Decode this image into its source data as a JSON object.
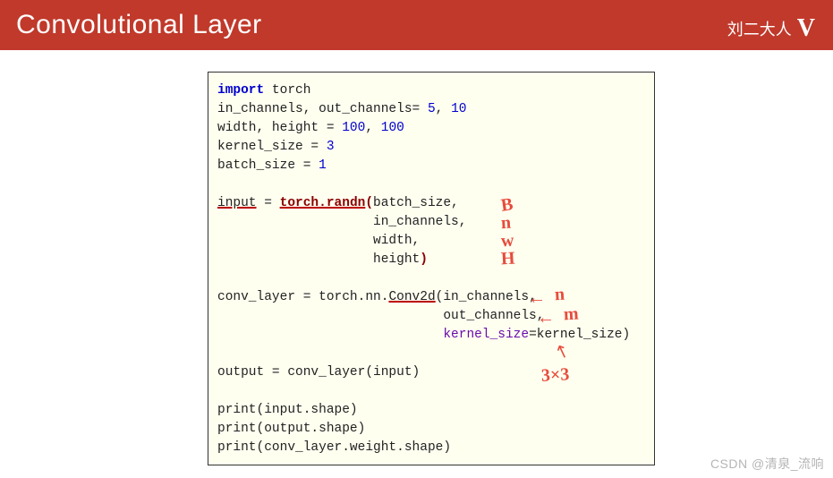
{
  "header": {
    "title": "Convolutional Layer",
    "author": "刘二大人"
  },
  "code": {
    "l1_kw": "import",
    "l1_rest": " torch",
    "l2a": "in_channels, out_channels= ",
    "l2n1": "5",
    "l2b": ", ",
    "l2n2": "10",
    "l3a": "width, height = ",
    "l3n1": "100",
    "l3b": ", ",
    "l3n2": "100",
    "l4a": "kernel_size = ",
    "l4n": "3",
    "l5a": "batch_size = ",
    "l5n": "1",
    "l7a": "input",
    "l7b": " = ",
    "l7call": "torch.randn",
    "l7p1": "(",
    "l7c": "batch_size,",
    "l8": "                    in_channels,",
    "l9": "                    width,",
    "l10a": "                    height",
    "l10p2": ")",
    "l12": "conv_layer = torch.nn.",
    "l12u": "Conv2d",
    "l12b": "(in_channels,",
    "l13": "                             out_channels,",
    "l14a": "                             ",
    "l14kw": "kernel_size",
    "l14b": "=kernel_size)",
    "l16": "output = conv_layer(input)",
    "l18": "print(input.shape)",
    "l19": "print(output.shape)",
    "l20": "print(conv_layer.weight.shape)"
  },
  "annotations": {
    "b": "B",
    "n1": "n",
    "w": "w",
    "h": "H",
    "arrow1": "←",
    "n2": "n",
    "arrow2": "←",
    "m": "m",
    "arrow3": "↖",
    "k": "3×3"
  },
  "watermark": "CSDN @清泉_流响"
}
